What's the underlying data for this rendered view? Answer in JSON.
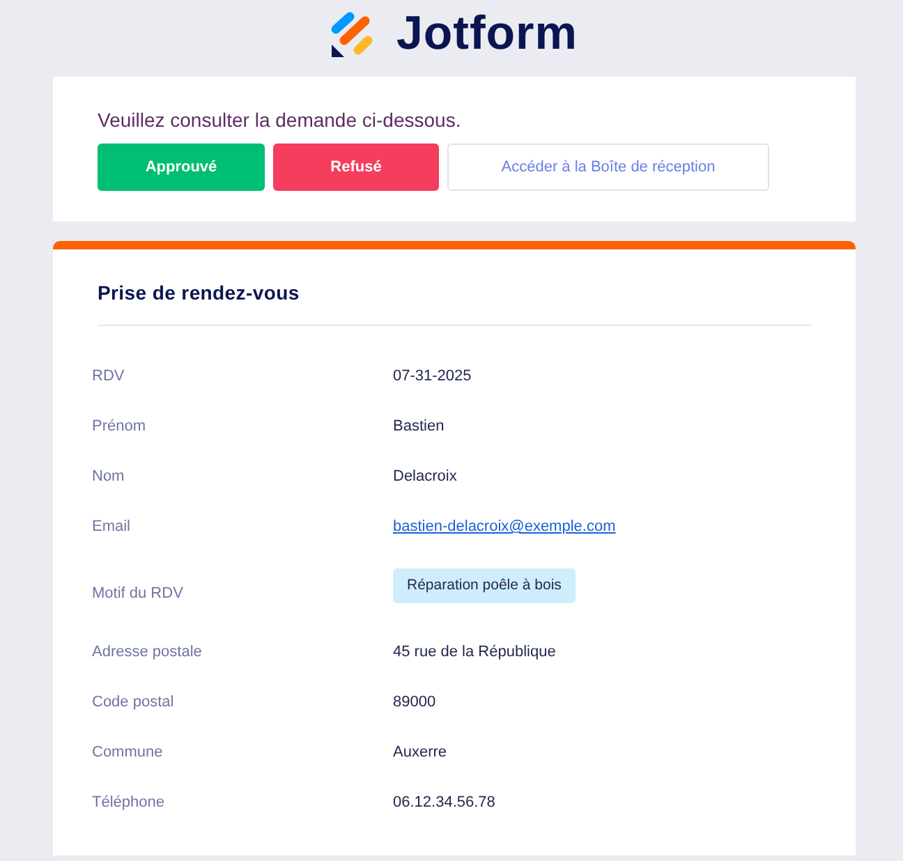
{
  "logo": {
    "name": "Jotform"
  },
  "request_card": {
    "message": "Veuillez consulter la demande ci-dessous.",
    "buttons": [
      {
        "label": "Approuvé",
        "kind": "approve"
      },
      {
        "label": "Refusé",
        "kind": "reject"
      },
      {
        "label": "Accéder à la Boîte de réception",
        "kind": "inbox"
      }
    ]
  },
  "submission": {
    "title": "Prise de rendez-vous",
    "fields": [
      {
        "label": "RDV",
        "value": "07-31-2025",
        "kind": "text"
      },
      {
        "label": "Prénom",
        "value": "Bastien",
        "kind": "text"
      },
      {
        "label": "Nom",
        "value": "Delacroix",
        "kind": "text"
      },
      {
        "label": "Email",
        "value": "bastien-delacroix@exemple.com",
        "kind": "link"
      },
      {
        "label": "Motif du RDV",
        "value": "Réparation poêle à bois",
        "kind": "tag"
      },
      {
        "label": "Adresse postale",
        "value": "45 rue de la République",
        "kind": "text"
      },
      {
        "label": "Code postal",
        "value": "89000",
        "kind": "text"
      },
      {
        "label": "Commune",
        "value": "Auxerre",
        "kind": "text"
      },
      {
        "label": "Téléphone",
        "value": "06.12.34.56.78",
        "kind": "text"
      }
    ]
  }
}
